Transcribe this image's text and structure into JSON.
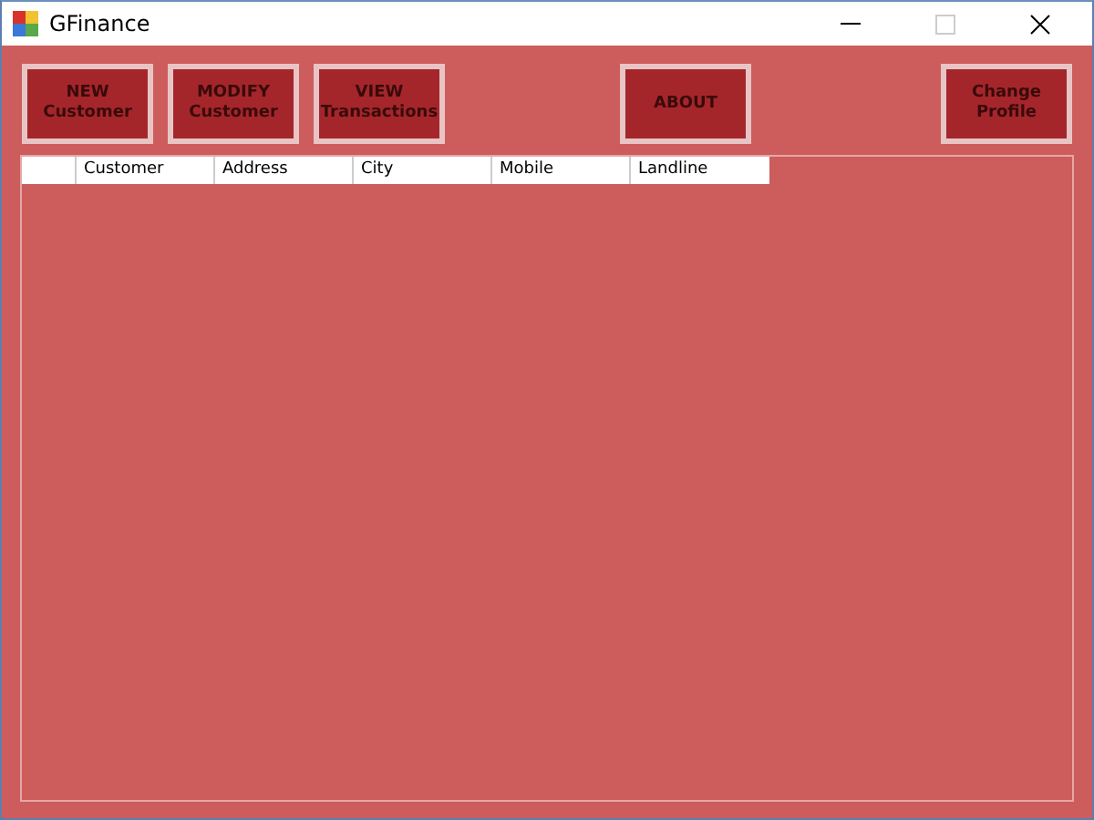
{
  "window": {
    "title": "GFinance"
  },
  "buttons": [
    {
      "label": "NEW\nCustomer"
    },
    {
      "label": "MODIFY\nCustomer"
    },
    {
      "label": "VIEW\nTransactions"
    },
    {
      "label": "ABOUT"
    },
    {
      "label": "Change Profile"
    }
  ],
  "table": {
    "columns": [
      "Customer",
      "Address",
      "City",
      "Mobile",
      "Landline"
    ]
  }
}
